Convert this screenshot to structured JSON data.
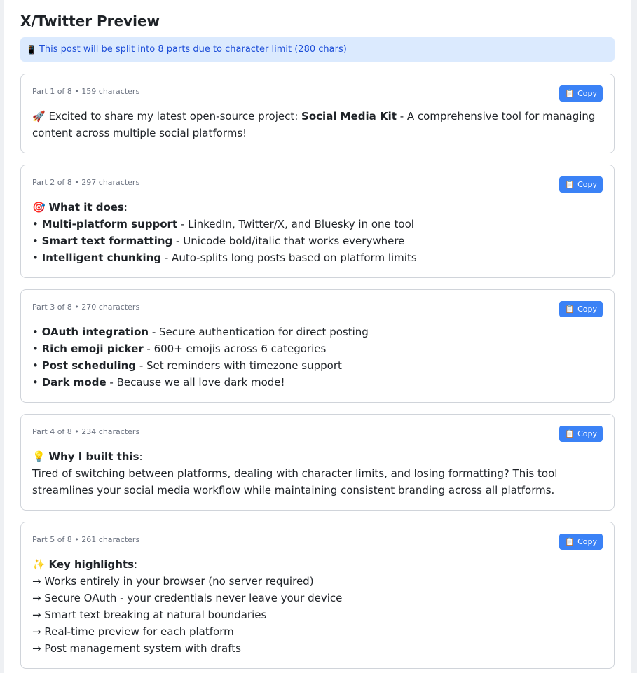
{
  "title": "X/Twitter Preview",
  "info": {
    "icon": "📱",
    "text": "This post will be split into 8 parts due to character limit (280 chars)"
  },
  "copy": {
    "icon": "📋",
    "label": "Copy"
  },
  "parts": [
    {
      "meta": "Part 1 of 8 • 159 characters",
      "p1": {
        "emoji": "🚀",
        "a": " Excited to share my latest open-source project: ",
        "b": "Social Media Kit",
        "c": " - A comprehensive tool for managing content across multiple social platforms!"
      }
    },
    {
      "meta": "Part 2 of 8 • 297 characters",
      "head": {
        "emoji": "🎯",
        "b": "What it does",
        "c": ":"
      },
      "items": [
        {
          "bullet": "• ",
          "b": "Multi-platform support",
          "c": " - LinkedIn, Twitter/X, and Bluesky in one tool"
        },
        {
          "bullet": "• ",
          "b": "Smart text formatting",
          "c": " - Unicode bold/italic that works everywhere"
        },
        {
          "bullet": "• ",
          "b": "Intelligent chunking",
          "c": " - Auto-splits long posts based on platform limits"
        }
      ]
    },
    {
      "meta": "Part 3 of 8 • 270 characters",
      "items": [
        {
          "bullet": "• ",
          "b": "OAuth integration",
          "c": " - Secure authentication for direct posting"
        },
        {
          "bullet": "• ",
          "b": "Rich emoji picker",
          "c": " - 600+ emojis across 6 categories"
        },
        {
          "bullet": "• ",
          "b": "Post scheduling",
          "c": " - Set reminders with timezone support"
        },
        {
          "bullet": "• ",
          "b": "Dark mode",
          "c": " - Because we all love dark mode!"
        }
      ]
    },
    {
      "meta": "Part 4 of 8 • 234 characters",
      "head": {
        "emoji": "💡",
        "b": "Why I built this",
        "c": ":"
      },
      "text": "Tired of switching between platforms, dealing with character limits, and losing formatting? This tool streamlines your social media workflow while maintaining consistent branding across all platforms."
    },
    {
      "meta": "Part 5 of 8 • 261 characters",
      "head": {
        "emoji": "✨",
        "b": "Key highlights",
        "c": ":"
      },
      "lines": [
        "→ Works entirely in your browser (no server required)",
        "→ Secure OAuth - your credentials never leave your device",
        "→ Smart text breaking at natural boundaries",
        "→ Real-time preview for each platform",
        "→ Post management system with drafts"
      ]
    }
  ]
}
